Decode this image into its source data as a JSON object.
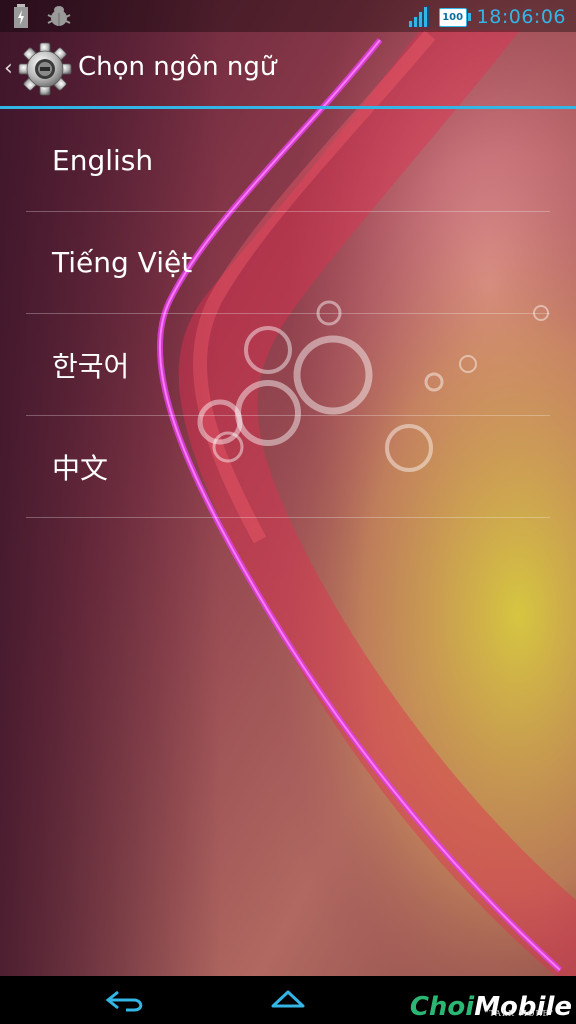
{
  "statusbar": {
    "time": "18:06:06",
    "battery_level": "100",
    "icons": [
      "battery-charging-icon",
      "debug-bug-icon",
      "signal-icon",
      "battery-icon"
    ]
  },
  "actionbar": {
    "title": "Chọn ngôn ngữ",
    "icon": "settings-gear-icon"
  },
  "languages": [
    {
      "label": "English"
    },
    {
      "label": "Tiếng Việt"
    },
    {
      "label": "한국어"
    },
    {
      "label": "中文"
    }
  ],
  "navbar": {
    "buttons": [
      "back-icon",
      "home-icon",
      "recent-apps-icon"
    ]
  },
  "watermark": {
    "brand_first": "Choi",
    "brand_second": "Mobile",
    "tagline": "\"TALK MORE\""
  },
  "colors": {
    "accent": "#33b5e5",
    "watermark_green": "#2bb673"
  }
}
